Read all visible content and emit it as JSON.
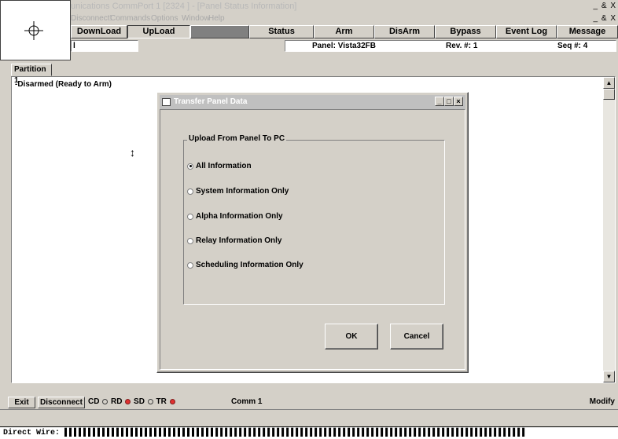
{
  "app": {
    "title": "unications CommPort 1 [2324 ] - [Panel Status Information]",
    "menu": [
      "Disconnect!",
      "Commands",
      "Options",
      "Window",
      "Help"
    ],
    "window_controls_outer": "_ & X",
    "window_controls_inner": "_ & X"
  },
  "toolbar": {
    "buttons": [
      {
        "label": "DownLoad"
      },
      {
        "label": "UpLoad"
      },
      {
        "label": ""
      },
      {
        "label": "Status"
      },
      {
        "label": "Arm"
      },
      {
        "label": "DisArm"
      },
      {
        "label": "Bypass"
      },
      {
        "label": "Event Log"
      },
      {
        "label": "Message"
      }
    ]
  },
  "info_row": {
    "left_field": "l",
    "panel": "Panel:  Vista32FB",
    "rev": "Rev. #:  1",
    "seq": "Seq #: 4"
  },
  "tab": {
    "label": "Partition 1"
  },
  "main": {
    "status": "-Disarmed  (Ready to Arm)",
    "cursor_glyph": "↕"
  },
  "dialog": {
    "title": "Transfer Panel Data",
    "controls": [
      "_",
      "□",
      "×"
    ],
    "group_title": "Upload From Panel To PC",
    "options": [
      {
        "label": "All Information",
        "checked": true
      },
      {
        "label": "System Information Only",
        "checked": false
      },
      {
        "label": "Alpha Information Only",
        "checked": false
      },
      {
        "label": "Relay Information Only",
        "checked": false
      },
      {
        "label": "Scheduling Information Only",
        "checked": false
      }
    ],
    "ok_label": "OK",
    "cancel_label": "Cancel"
  },
  "bottom_bar": {
    "exit_label": "Exit",
    "disconnect_label": "Disconnect",
    "cd": "CD",
    "rd": "RD",
    "sd": "SD",
    "tr": "TR",
    "comm": "Comm 1",
    "modify": "Modify"
  },
  "direct_wire": {
    "label": "Direct Wire:",
    "bars": "▌▌▌▌▌▌▌▌▌▌▌▌▌▌▌▌▌▌▌▌▌▌▌▌▌▌▌▌▌▌▌▌▌▌▌▌▌▌▌▌▌▌▌▌▌▌▌▌▌▌▌▌▌▌▌▌▌▌▌▌▌▌▌▌▌▌▌▌▌▌▌▌▌▌▌▌▌▌▌▌▌▌▌▌▌▌▌▌▌▌▌▌▌▌▌▌▌▌"
  },
  "colors": {
    "face": "#d4d0c8",
    "led_on": "#e03030"
  }
}
